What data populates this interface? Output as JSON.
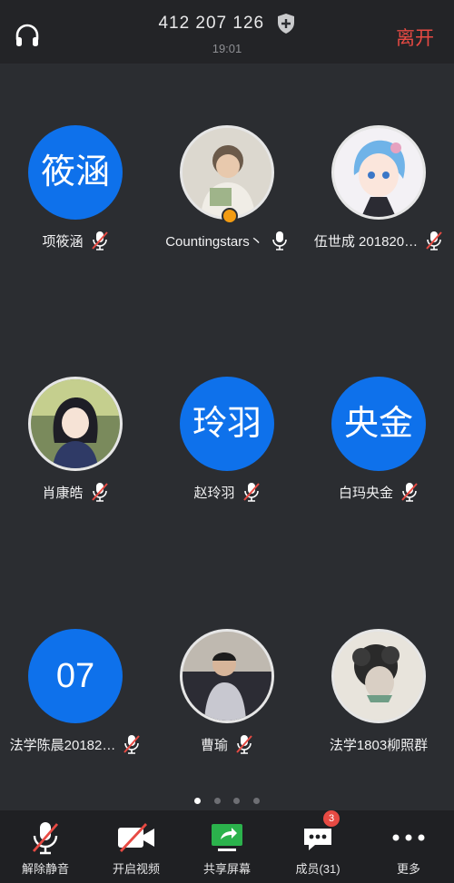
{
  "header": {
    "meeting_id": "412 207 126",
    "time": "19:01",
    "leave_label": "离开"
  },
  "participants": [
    {
      "name": "项筱涵",
      "avatar_text": "筱涵",
      "avatar_type": "text",
      "mic": "muted"
    },
    {
      "name": "Countingstars丶",
      "avatar_type": "photo",
      "avatar_icon": "photo-avatar-icon",
      "mic": "on",
      "badge": "host-badge"
    },
    {
      "name": "伍世成 201820…",
      "avatar_type": "photo",
      "avatar_icon": "anime-avatar-icon",
      "mic": "muted"
    },
    {
      "name": "肖康皓",
      "avatar_type": "photo",
      "avatar_icon": "anime-avatar-icon",
      "mic": "muted"
    },
    {
      "name": "赵玲羽",
      "avatar_text": "玲羽",
      "avatar_type": "text",
      "mic": "muted"
    },
    {
      "name": "白玛央金",
      "avatar_text": "央金",
      "avatar_type": "text",
      "mic": "muted"
    },
    {
      "name": "法学陈晨20182…",
      "avatar_text": "07",
      "avatar_type": "text",
      "mic": "muted"
    },
    {
      "name": "曹瑜",
      "avatar_type": "photo",
      "avatar_icon": "child-photo-avatar-icon",
      "mic": "muted"
    },
    {
      "name": "法学1803柳照群",
      "avatar_type": "photo",
      "avatar_icon": "sketch-avatar-icon",
      "mic": "none"
    }
  ],
  "pagination": {
    "pages": 4,
    "active": 1
  },
  "toolbar": {
    "unmute_label": "解除静音",
    "video_label": "开启视频",
    "share_label": "共享屏幕",
    "members_label": "成员(31)",
    "members_badge": "3",
    "more_label": "更多"
  },
  "colors": {
    "accent_blue": "#0e71eb",
    "leave_red": "#e74a43",
    "share_green": "#2bb24c",
    "background": "#2b2d31"
  }
}
